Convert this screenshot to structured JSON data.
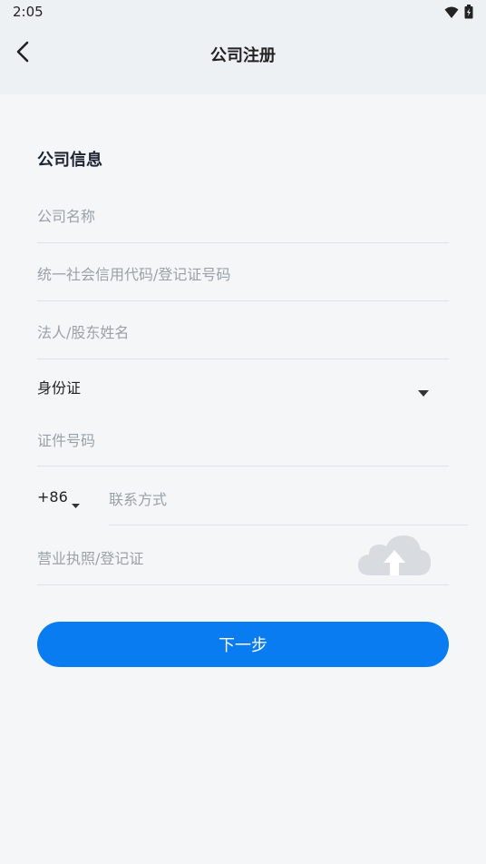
{
  "status_bar": {
    "time": "2:05"
  },
  "header": {
    "title": "公司注册"
  },
  "form": {
    "section_title": "公司信息",
    "company_name_placeholder": "公司名称",
    "credit_code_placeholder": "统一社会信用代码/登记证号码",
    "legal_person_placeholder": "法人/股东姓名",
    "id_type_value": "身份证",
    "id_number_placeholder": "证件号码",
    "country_code": "+86",
    "contact_placeholder": "联系方式",
    "license_label": "营业执照/登记证"
  },
  "actions": {
    "next_label": "下一步"
  },
  "colors": {
    "accent": "#0a7cf2",
    "placeholder": "#9aa1a8",
    "divider": "#dfe3e7"
  },
  "icons": [
    "wifi-icon",
    "battery-icon",
    "back-arrow-icon",
    "dropdown-caret-icon",
    "cloud-upload-icon"
  ]
}
